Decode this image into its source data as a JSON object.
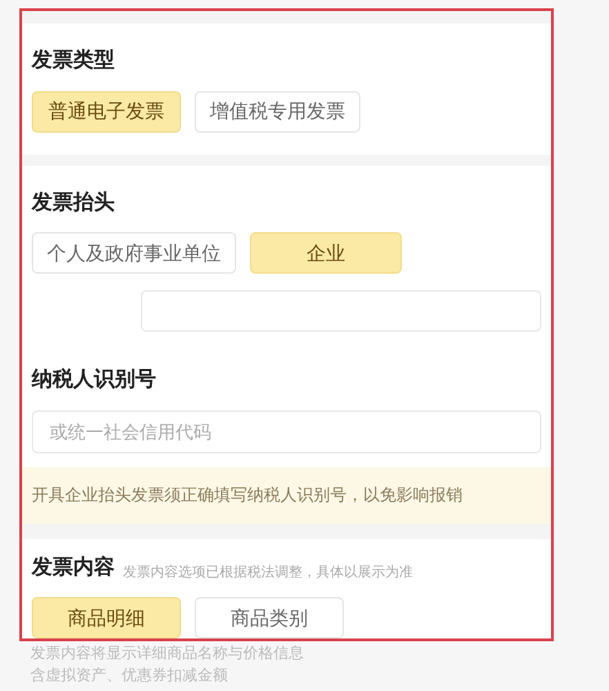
{
  "invoice_type": {
    "title": "发票类型",
    "options": [
      {
        "label": "普通电子发票",
        "selected": true
      },
      {
        "label": "增值税专用发票",
        "selected": false
      }
    ]
  },
  "invoice_header": {
    "title": "发票抬头",
    "options": [
      {
        "label": "个人及政府事业单位",
        "selected": false
      },
      {
        "label": "企业",
        "selected": true
      }
    ]
  },
  "taxpayer_id": {
    "title": "纳税人识别号",
    "placeholder": "或统一社会信用代码"
  },
  "notice": "开具企业抬头发票须正确填写纳税人识别号，以免影响报销",
  "invoice_content": {
    "title": "发票内容",
    "hint": "发票内容选项已根据税法调整，具体以展示为准",
    "options": [
      {
        "label": "商品明细",
        "selected": true
      },
      {
        "label": "商品类别",
        "selected": false
      }
    ]
  },
  "footnote": [
    "发票内容将显示详细商品名称与价格信息",
    "含虚拟资产、优惠券扣减金额"
  ]
}
